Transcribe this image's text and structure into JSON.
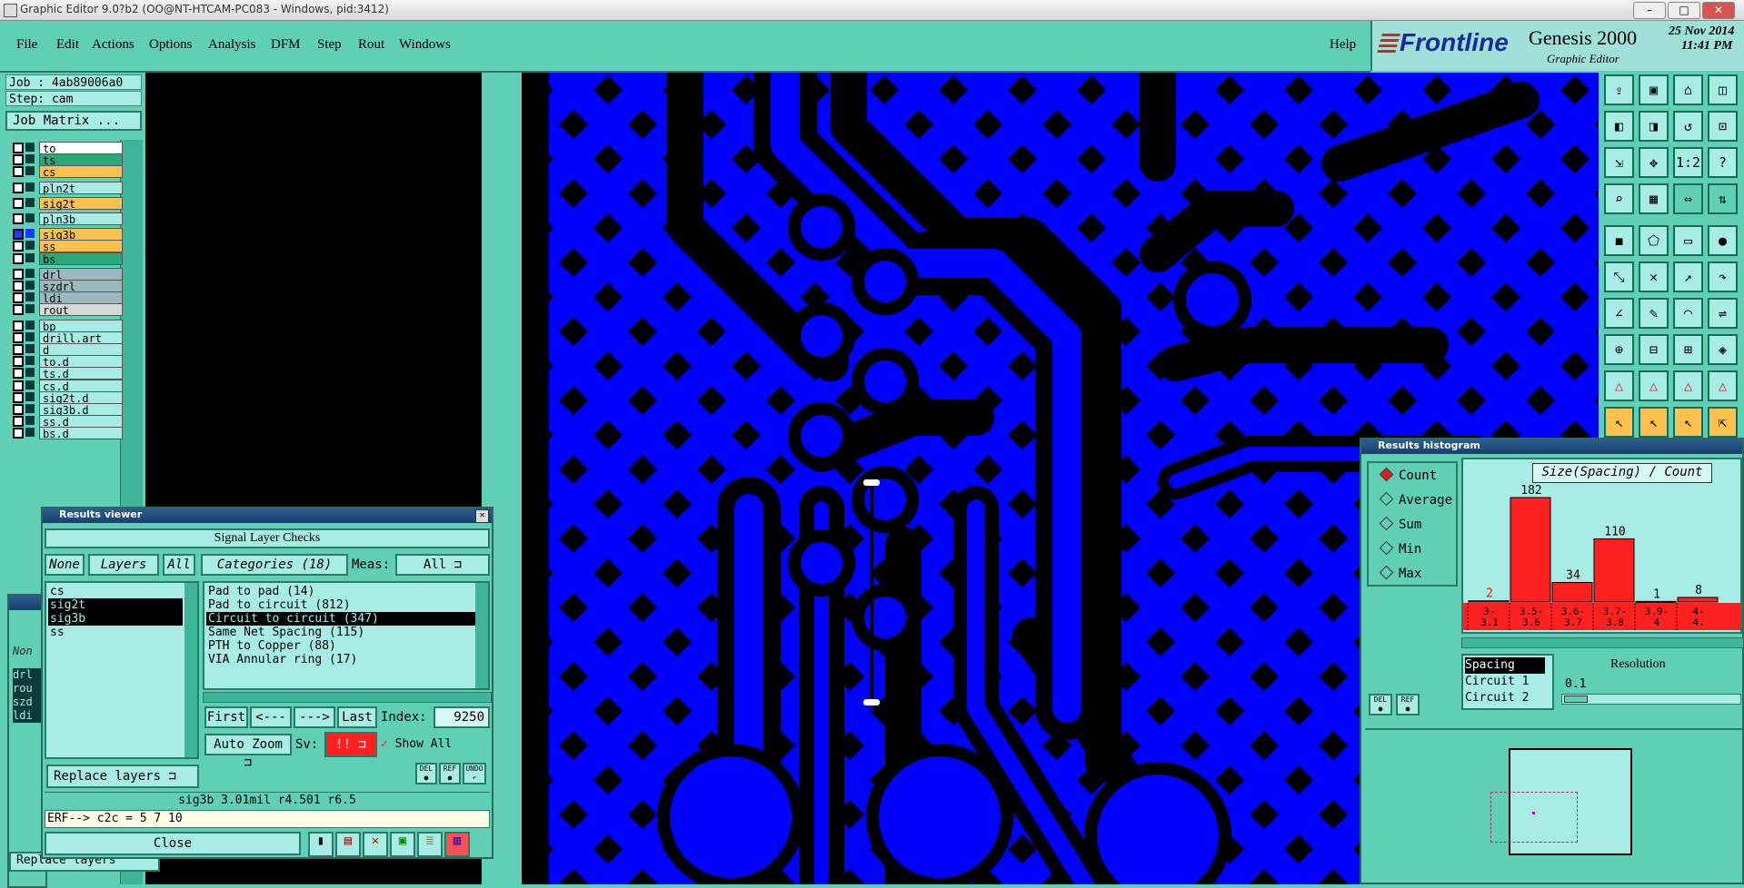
{
  "window": {
    "title": "Graphic Editor 9.0?b2 (OO@NT-HTCAM-PC083 - Windows, pid:3412)"
  },
  "menu": {
    "items": [
      "File",
      "Edit",
      "Actions",
      "Options",
      "Analysis",
      "DFM",
      "Step",
      "Rout",
      "Windows"
    ],
    "help": "Help"
  },
  "brand": {
    "logo": "Frontline",
    "product": "Genesis 2000",
    "subtitle": "Graphic Editor",
    "date": "25 Nov 2014",
    "time": "11:41 PM"
  },
  "job": {
    "job_label": "Job : 4ab89006a0",
    "step_label": "Step: cam",
    "matrix_button": "Job Matrix ..."
  },
  "layers": [
    {
      "name": "to",
      "color": "#ffffff"
    },
    {
      "name": "ts",
      "color": "#2aa878"
    },
    {
      "name": "cs",
      "color": "#ffc14d"
    },
    {
      "name": "pln2t",
      "color": "#a8ece6"
    },
    {
      "name": "sig2t",
      "color": "#ffc14d"
    },
    {
      "name": "pln3b",
      "color": "#a8ece6"
    },
    {
      "name": "sig3b",
      "color": "#ffc14d"
    },
    {
      "name": "ss",
      "color": "#ffc14d"
    },
    {
      "name": "bs",
      "color": "#2aa878"
    },
    {
      "name": "drl",
      "color": "#9ab8c0"
    },
    {
      "name": "szdrl",
      "color": "#9ab8c0"
    },
    {
      "name": "ldi",
      "color": "#9ab8c0"
    },
    {
      "name": "rout",
      "color": "#d8d8d8"
    },
    {
      "name": "bp",
      "color": "#a8ece6"
    },
    {
      "name": "drill.art",
      "color": "#a8ece6"
    },
    {
      "name": "d",
      "color": "#a8ece6"
    },
    {
      "name": "to.d",
      "color": "#a8ece6"
    },
    {
      "name": "ts.d",
      "color": "#a8ece6"
    },
    {
      "name": "cs.d",
      "color": "#a8ece6"
    },
    {
      "name": "sig2t.d",
      "color": "#a8ece6"
    },
    {
      "name": "sig3b.d",
      "color": "#a8ece6"
    },
    {
      "name": "ss.d",
      "color": "#a8ece6"
    },
    {
      "name": "bs.d",
      "color": "#a8ece6"
    }
  ],
  "results_viewer": {
    "title": "Results viewer",
    "heading": "Signal Layer Checks",
    "none_btn": "None",
    "layers_btn": "Layers",
    "all_btn": "All",
    "categories_btn": "Categories (18)",
    "meas_label": "Meas:",
    "meas_value": "All",
    "layer_list": [
      "cs",
      "sig2t",
      "sig3b",
      "ss"
    ],
    "categories": [
      "Pad to pad (14)",
      "Pad to circuit (812)",
      "Circuit to circuit (347)",
      "Same Net Spacing (115)",
      "PTH to Copper (88)",
      "VIA Annular ring (17)"
    ],
    "first_btn": "First",
    "prev_btn": "<---",
    "next_btn": "--->",
    "last_btn": "Last",
    "index_label": "Index:",
    "index_value": "9250",
    "auto_zoom": "Auto Zoom",
    "sv_label": "Sv:",
    "sv_value": "!!",
    "show_all": "Show All",
    "replace_layers": "Replace layers",
    "status": "sig3b 3.01mil  r4.501  r6.5",
    "erf": "ERF--> c2c = 5 7 10",
    "close": "Close"
  },
  "background_panel": {
    "replace_layers": "Replace layers",
    "none_btn": "Non",
    "layers": [
      "drl",
      "rou",
      "szd",
      "ldi"
    ]
  },
  "histogram": {
    "title": "Results histogram",
    "options": [
      "Count",
      "Average",
      "Sum",
      "Min",
      "Max"
    ],
    "selected": "Count",
    "chart_title": "Size(Spacing) / Count",
    "bins": [
      "3-\n3.1",
      "3.5-\n3.6",
      "3.6-\n3.7",
      "3.7-\n3.8",
      "3.9-\n4",
      "4-\n4."
    ],
    "spacing_list": [
      "Spacing",
      "Circuit 1",
      "Circuit 2"
    ],
    "resolution_label": "Resolution",
    "resolution_value": "0.1"
  },
  "chart_data": {
    "type": "bar",
    "title": "Size(Spacing) / Count",
    "categories": [
      "3-3.1",
      "3.5-3.6",
      "3.6-3.7",
      "3.7-3.8",
      "3.9-4",
      "4-4."
    ],
    "values": [
      2,
      182,
      34,
      110,
      1,
      8
    ],
    "ylim": [
      0,
      182
    ]
  },
  "icons": [
    "open-icon",
    "save-icon",
    "home-icon",
    "window-icon",
    "prev-icon",
    "next-icon",
    "undo-icon",
    "snap-icon",
    "fit-icon",
    "pan-icon",
    "ratio-icon",
    "help-icon",
    "zoom-icon",
    "grid-icon",
    "measure-icon",
    "net-icon",
    "pad-icon",
    "poly-icon",
    "line-icon",
    "circle-icon",
    "connect-icon",
    "cross-icon",
    "move-icon",
    "rotate-icon",
    "angle-icon",
    "draw-icon",
    "arc-icon",
    "mirror-icon",
    "drill-icon",
    "trim-icon",
    "array-icon",
    "node-icon",
    "triangle-icon",
    "triangle2-icon",
    "triangle3-icon",
    "triangle4-icon",
    "pointer-icon",
    "select-icon",
    "select2-icon",
    "multi-icon"
  ],
  "colors": {
    "panel": "#5fcfb5",
    "copper": "#0000ff",
    "highlight": "#ffc14d",
    "bars": "#ff2020"
  }
}
